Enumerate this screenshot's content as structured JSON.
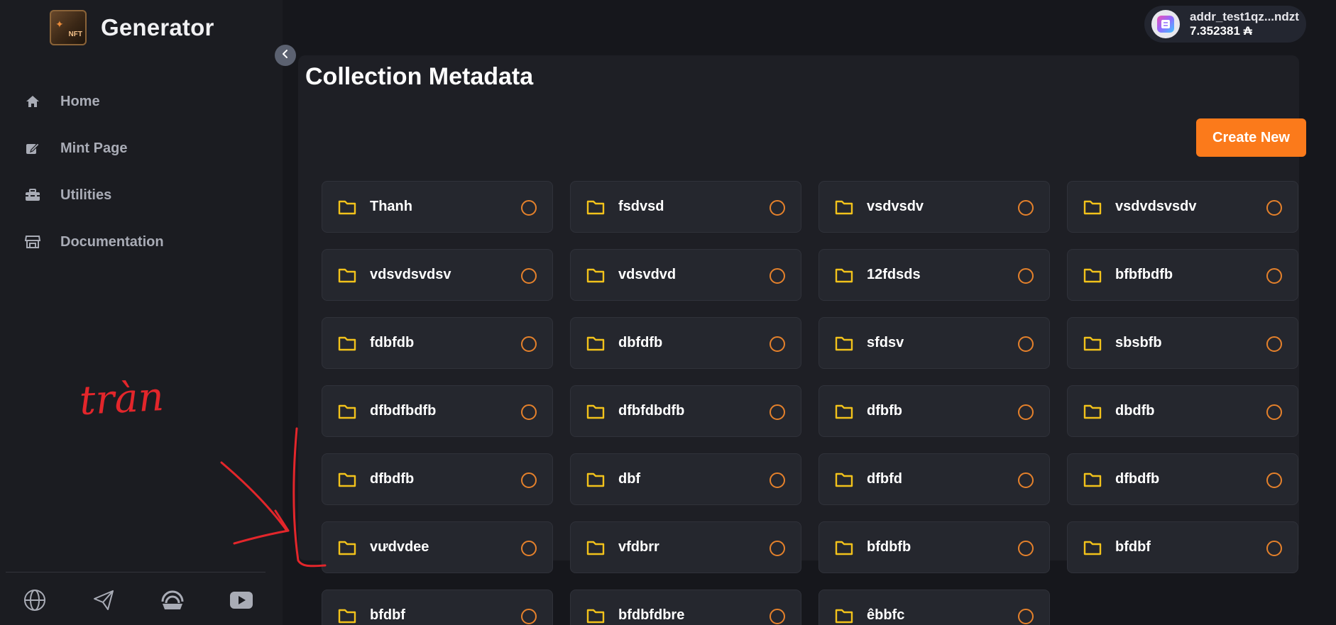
{
  "brand": {
    "title": "Generator",
    "logo_text": "NFT",
    "logo_mark": "✦"
  },
  "nav": {
    "items": [
      {
        "label": "Home",
        "icon": "home-icon"
      },
      {
        "label": "Mint Page",
        "icon": "edit-icon"
      },
      {
        "label": "Utilities",
        "icon": "toolbox-icon"
      },
      {
        "label": "Documentation",
        "icon": "store-icon"
      }
    ]
  },
  "social": {
    "items": [
      {
        "icon": "globe-icon"
      },
      {
        "icon": "telegram-icon"
      },
      {
        "icon": "discord-icon"
      },
      {
        "icon": "youtube-icon"
      }
    ]
  },
  "wallet": {
    "address": "addr_test1qz...ndzt",
    "balance": "7.352381 ₳"
  },
  "page": {
    "title": "Collection Metadata",
    "create_button": "Create New"
  },
  "collections": [
    "Thanh",
    "fsdvsd",
    "vsdvsdv",
    "vsdvdsvsdv",
    "vdsvdsvdsv",
    "vdsvdvd",
    "12fdsds",
    "bfbfbdfb",
    "fdbfdb",
    "dbfdfb",
    "sfdsv",
    "sbsbfb",
    "dfbdfbdfb",
    "dfbfdbdfb",
    "dfbfb",
    "dbdfb",
    "dfbdfb",
    "dbf",
    "dfbfd",
    "dfbdfb",
    "vưdvdee",
    "vfdbrr",
    "bfdbfb",
    "bfdbf",
    "bfdbf",
    "bfdbfdbre",
    "êbbfc"
  ],
  "annotation": {
    "handwritten": "tràn",
    "color": "#e3262b"
  },
  "colors": {
    "accent": "#fb7a1b",
    "folder": "#f2c21b",
    "background": "#16171c",
    "panel": "#1e1f25"
  }
}
